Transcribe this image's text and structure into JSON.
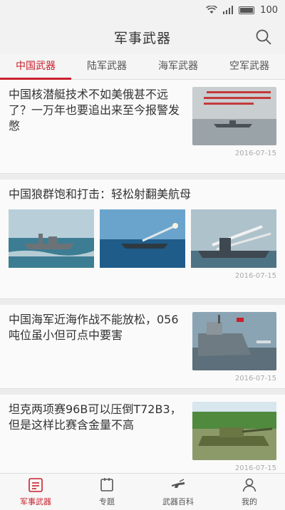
{
  "status": {
    "battery": "100"
  },
  "header": {
    "title": "军事武器"
  },
  "tabs": [
    {
      "label": "中国武器"
    },
    {
      "label": "陆军武器"
    },
    {
      "label": "海军武器"
    },
    {
      "label": "空军武器"
    }
  ],
  "articles": [
    {
      "title": "中国核潜艇技术不如美俄甚不远了？一万年也要追出来至今报警发憋",
      "date": "2016-07-15"
    },
    {
      "title": "中国狼群饱和打击：轻松射翻美航母",
      "date": "2016-07-15"
    },
    {
      "title": "中国海军近海作战不能放松，056吨位虽小但可点中要害",
      "date": "2016-07-15"
    },
    {
      "title": "坦克两项赛96B可以压倒T72B3，但是这样比赛含金量不高",
      "date": "2016-07-15"
    }
  ],
  "nav": [
    {
      "label": "军事武器",
      "icon": "news-icon"
    },
    {
      "label": "专题",
      "icon": "topic-icon"
    },
    {
      "label": "武器百科",
      "icon": "encyclopedia-icon"
    },
    {
      "label": "我的",
      "icon": "profile-icon"
    }
  ],
  "colors": {
    "accent": "#c8202c"
  }
}
